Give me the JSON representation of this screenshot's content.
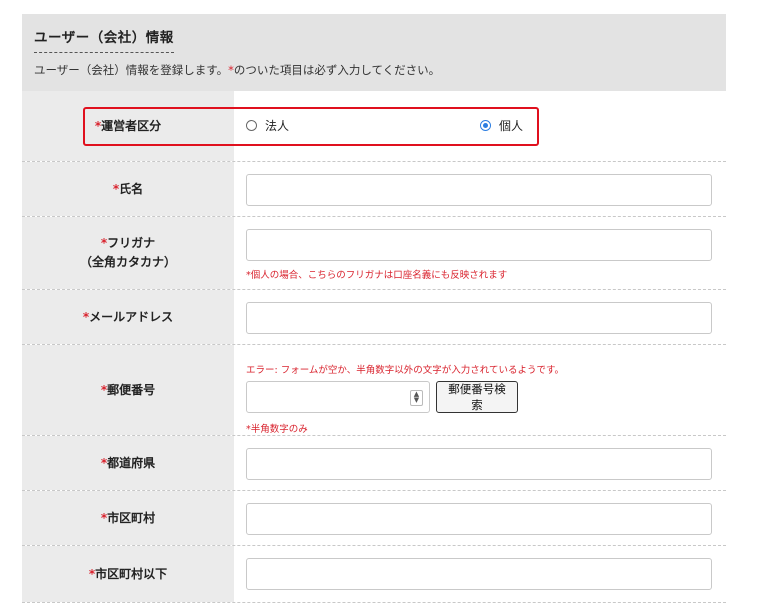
{
  "section": {
    "title": "ユーザー（会社）情報",
    "desc_before": "ユーザー（会社）情報を登録します。",
    "desc_mark": "*",
    "desc_after": "のついた項目は必ず入力してください。"
  },
  "required_mark": "*",
  "fields": {
    "operator_type": {
      "label": "運営者区分",
      "options": [
        "法人",
        "個人"
      ],
      "selected": "個人"
    },
    "name": {
      "label": "氏名",
      "value": ""
    },
    "furigana": {
      "label": "フリガナ",
      "label_sub": "（全角カタカナ）",
      "value": "",
      "help": "*個人の場合、こちらのフリガナは口座名義にも反映されます"
    },
    "email": {
      "label": "メールアドレス",
      "value": ""
    },
    "postal": {
      "label": "郵便番号",
      "error": "エラー: フォームが空か、半角数字以外の文字が入力されているようです。",
      "value": "",
      "button": "郵便番号検索",
      "help": "*半角数字のみ"
    },
    "prefecture": {
      "label": "都道府県",
      "value": ""
    },
    "city": {
      "label": "市区町村",
      "value": ""
    },
    "address": {
      "label": "市区町村以下",
      "value": ""
    }
  }
}
